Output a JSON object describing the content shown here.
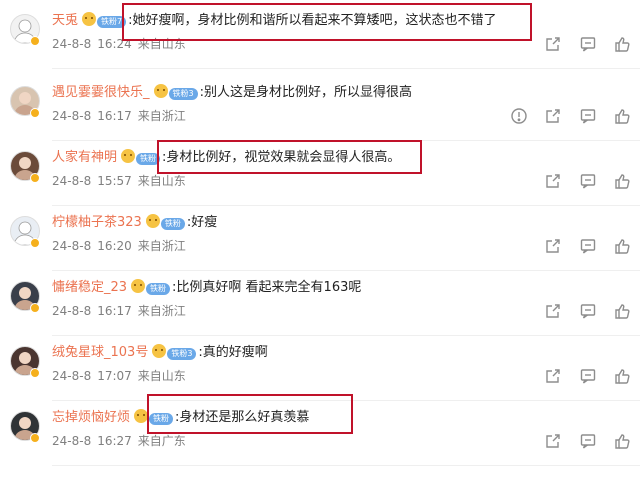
{
  "comments": [
    {
      "user": "天兎",
      "content": ":她好瘦啊，身材比例和谐所以看起来不算矮吧，这状态也不错了",
      "date": "24-8-8",
      "time": "16:24",
      "location": "来自山东",
      "level": "铁粉7"
    },
    {
      "user": "遇见霎霎很快乐_",
      "content": ":别人这是身材比例好，所以显得很高",
      "date": "24-8-8",
      "time": "16:17",
      "location": "来自浙江",
      "level": "铁粉3"
    },
    {
      "user": "人家有神明",
      "content": ":身材比例好，视觉效果就会显得人很高。",
      "date": "24-8-8",
      "time": "15:57",
      "location": "来自山东",
      "level": "铁粉"
    },
    {
      "user": "柠檬柚子茶323",
      "content": ":好瘦",
      "date": "24-8-8",
      "time": "16:20",
      "location": "来自浙江",
      "level": "铁粉"
    },
    {
      "user": "慵绪稳定_23",
      "content": ":比例真好啊 看起来完全有163呢",
      "date": "24-8-8",
      "time": "16:17",
      "location": "来自浙江",
      "level": "铁粉"
    },
    {
      "user": "绒兔星球_103号",
      "content": ":真的好瘦啊",
      "date": "24-8-8",
      "time": "17:07",
      "location": "来自山东",
      "level": "铁粉3"
    },
    {
      "user": "忘掉烦恼好烦",
      "content": ":身材还是那么好真羡慕",
      "date": "24-8-8",
      "time": "16:27",
      "location": "来自广东",
      "level": "铁粉"
    }
  ],
  "colors": {
    "username": "#eb7350",
    "highlight": "#c0122a",
    "meta": "#808080",
    "level_badge": "#6aa8e8"
  },
  "icons": [
    "report-icon",
    "forward-icon",
    "comment-icon",
    "like-icon"
  ]
}
